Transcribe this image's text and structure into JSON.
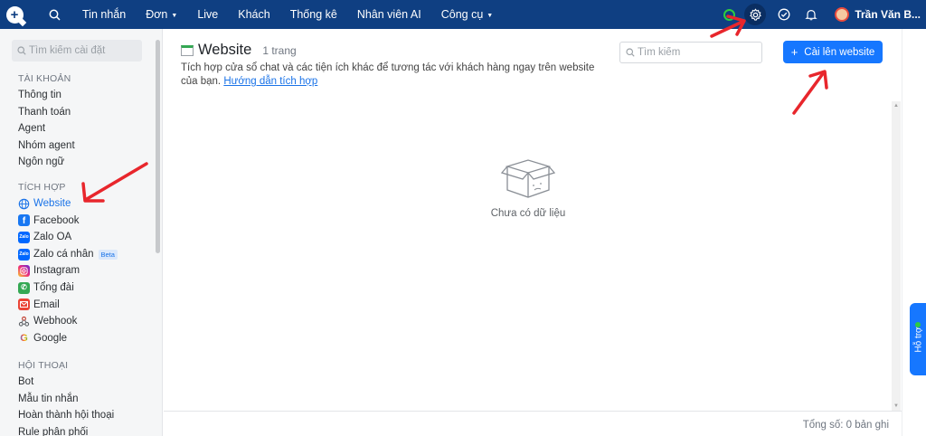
{
  "nav": {
    "items": [
      {
        "label": "Tin nhắn",
        "dropdown": false
      },
      {
        "label": "Đơn",
        "dropdown": true
      },
      {
        "label": "Live",
        "dropdown": false
      },
      {
        "label": "Khách",
        "dropdown": false
      },
      {
        "label": "Thống kê",
        "dropdown": false
      },
      {
        "label": "Nhân viên AI",
        "dropdown": false
      },
      {
        "label": "Công cụ",
        "dropdown": true
      }
    ],
    "user_name": "Trần Văn B...",
    "icons": [
      "logo-icon",
      "search-icon",
      "status-icon",
      "gear-icon",
      "check-circle-icon",
      "bell-icon"
    ]
  },
  "sidebar": {
    "search_placeholder": "Tìm kiếm cài đặt",
    "groups": [
      {
        "heading": "TÀI KHOẢN",
        "items": [
          {
            "label": "Thông tin"
          },
          {
            "label": "Thanh toán"
          },
          {
            "label": "Agent"
          },
          {
            "label": "Nhóm agent"
          },
          {
            "label": "Ngôn ngữ"
          }
        ]
      },
      {
        "heading": "TÍCH HỢP",
        "items": [
          {
            "label": "Website",
            "icon": "globe-icon",
            "color": "#1a73e8",
            "active": true
          },
          {
            "label": "Facebook",
            "icon": "facebook-icon",
            "color": "#1877f2"
          },
          {
            "label": "Zalo OA",
            "icon": "zalo-icon",
            "color": "#0068ff"
          },
          {
            "label": "Zalo cá nhân",
            "icon": "zalo-personal-icon",
            "color": "#0068ff",
            "badge": "Beta"
          },
          {
            "label": "Instagram",
            "icon": "instagram-icon",
            "color": "#d6249f"
          },
          {
            "label": "Tổng đài",
            "icon": "phone-icon",
            "color": "#34a853"
          },
          {
            "label": "Email",
            "icon": "email-icon",
            "color": "#ea4335"
          },
          {
            "label": "Webhook",
            "icon": "webhook-icon",
            "color": "#5f6368"
          },
          {
            "label": "Google",
            "icon": "google-icon",
            "color": "#4285f4"
          }
        ]
      },
      {
        "heading": "HỘI THOẠI",
        "items": [
          {
            "label": "Bot"
          },
          {
            "label": "Mẫu tin nhắn"
          },
          {
            "label": "Hoàn thành hội thoại"
          },
          {
            "label": "Rule phân phối"
          }
        ]
      }
    ]
  },
  "main": {
    "title": "Website",
    "count": "1 trang",
    "description": "Tích hợp cửa sổ chat và các tiện ích khác để tương tác với khách hàng ngay trên website của bạn.",
    "guide_link": "Hướng dẫn tích hợp",
    "search_placeholder": "Tìm kiếm",
    "install_button": "Cài lên website",
    "empty_text": "Chưa có dữ liệu",
    "total": "Tổng số: 0 bản ghi"
  },
  "support": {
    "label": "Hỗ trợ"
  },
  "colors": {
    "topbar": "#0f3f82",
    "primary": "#1677ff",
    "annotation": "#e8262c"
  }
}
